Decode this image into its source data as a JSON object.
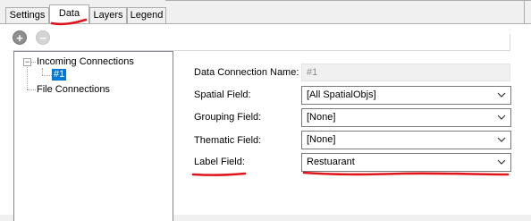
{
  "tabs": [
    {
      "label": "Settings"
    },
    {
      "label": "Data"
    },
    {
      "label": "Layers"
    },
    {
      "label": "Legend"
    }
  ],
  "toolbar": {
    "add_icon": "plus-circle-icon",
    "remove_icon": "minus-circle-icon",
    "add_glyph": "+",
    "remove_glyph": "−"
  },
  "tree": {
    "root_label": "Incoming Connections",
    "expander_glyph": "−",
    "selected_item": "#1",
    "file_label": "File Connections"
  },
  "form": {
    "connection_name": {
      "label": "Data Connection Name:",
      "value": "#1"
    },
    "spatial_field": {
      "label": "Spatial Field:",
      "value": "[All SpatialObjs]"
    },
    "grouping_field": {
      "label": "Grouping Field:",
      "value": "[None]"
    },
    "thematic_field": {
      "label": "Thematic Field:",
      "value": "[None]"
    },
    "label_field": {
      "label": "Label Field:",
      "value": "Restuarant"
    }
  },
  "colors": {
    "selection": "#0078d7",
    "annotation": "#e0141b"
  }
}
